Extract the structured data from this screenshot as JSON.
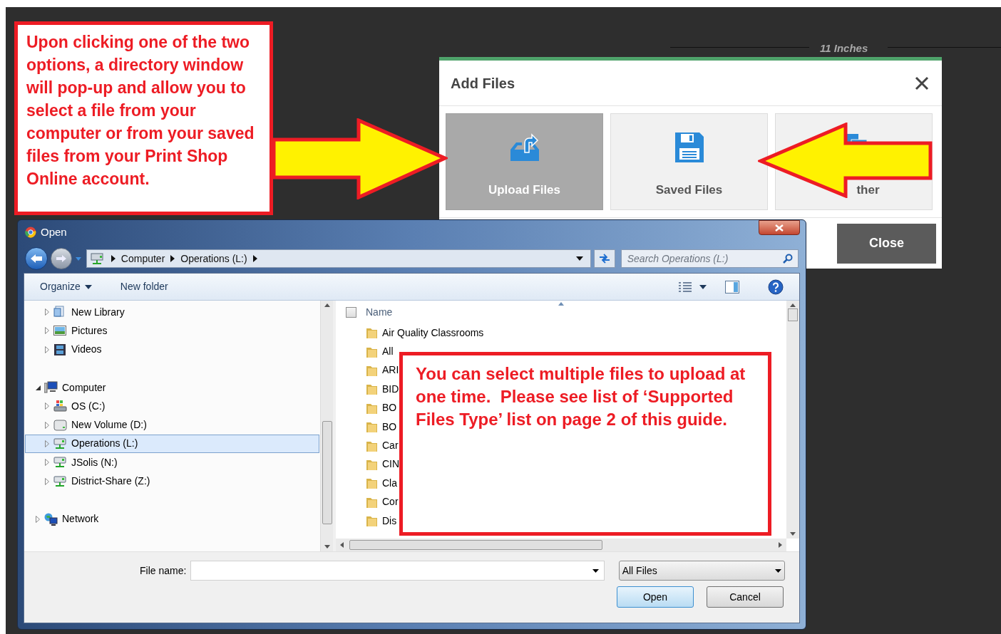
{
  "ruler": {
    "label": "11 Inches"
  },
  "add_files": {
    "title": "Add Files",
    "options": [
      {
        "label": "Upload Files",
        "kind": "upload",
        "selected": true
      },
      {
        "label": "Saved Files",
        "kind": "saved",
        "selected": false
      },
      {
        "label": "ther",
        "kind": "other",
        "selected": false
      }
    ],
    "close_button": "Close"
  },
  "open_dialog": {
    "title": "Open",
    "breadcrumb": [
      "Computer",
      "Operations (L:)"
    ],
    "search": {
      "placeholder": "Search Operations (L:)"
    },
    "toolbar": [
      "Organize",
      "New folder"
    ],
    "nav_tree": [
      {
        "label": "New Library",
        "kind": "library",
        "expanded": false,
        "selected": false
      },
      {
        "label": "Pictures",
        "kind": "pictures",
        "expanded": false,
        "selected": false
      },
      {
        "label": "Videos",
        "kind": "videos",
        "expanded": false,
        "selected": false
      },
      {
        "label": "Computer",
        "kind": "computer",
        "expanded": true,
        "selected": false,
        "children": [
          {
            "label": "OS (C:)",
            "kind": "os-drive",
            "expanded": false,
            "selected": false
          },
          {
            "label": "New Volume (D:)",
            "kind": "drive",
            "expanded": false,
            "selected": false
          },
          {
            "label": "Operations (L:)",
            "kind": "network-drive",
            "expanded": false,
            "selected": true
          },
          {
            "label": "JSolis (N:)",
            "kind": "network-drive",
            "expanded": false,
            "selected": false
          },
          {
            "label": "District-Share (Z:)",
            "kind": "network-drive",
            "expanded": false,
            "selected": false
          }
        ]
      },
      {
        "label": "Network",
        "kind": "network",
        "expanded": false,
        "selected": false
      }
    ],
    "select_all": {
      "checked": false
    },
    "list_column": "Name",
    "files": [
      "Air Quality Classrooms",
      "All",
      "ARI",
      "BID",
      "BO",
      "BO",
      "Car",
      "CIN",
      "Cla",
      "Cor",
      "Dis"
    ],
    "file_name_label": "File name:",
    "file_type": "All Files",
    "buttons": [
      {
        "label": "Open",
        "default": true
      },
      {
        "label": "Cancel",
        "default": false
      }
    ]
  },
  "callouts": [
    {
      "text": "Upon clicking one of the two options, a directory window will pop-up and allow you to select a file from your computer or from your saved files from your Print Shop Online account."
    },
    {
      "text": "You can select multiple files to upload at one time.  Please see list of ‘Supported Files Type’ list on page 2 of this guide."
    }
  ]
}
